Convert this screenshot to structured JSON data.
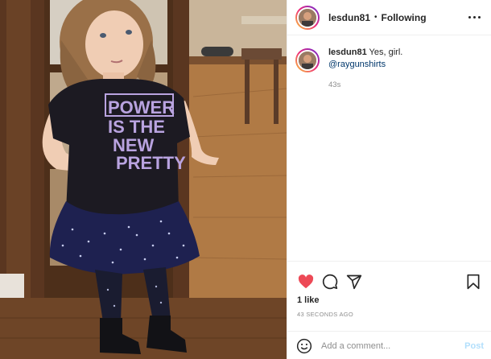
{
  "post": {
    "username": "lesdun81",
    "separator": "•",
    "follow_status": "Following",
    "shirt_text": [
      "POWER",
      "IS THE",
      "NEW",
      "PRETTY"
    ]
  },
  "caption": {
    "username": "lesdun81",
    "text": " Yes, girl.",
    "mention": "@raygunshirts",
    "time": "43s"
  },
  "actions": {
    "likes": "1 like",
    "timestamp": "43 SECONDS AGO"
  },
  "comment_box": {
    "placeholder": "Add a comment...",
    "post_label": "Post"
  },
  "colors": {
    "like_red": "#ed4956",
    "mention_blue": "#00376b",
    "post_disabled": "#b2dffc",
    "shirt_print": "#b9a3e0"
  },
  "icons": [
    "heart-icon",
    "comment-icon",
    "share-icon",
    "bookmark-icon",
    "more-icon",
    "emoji-icon"
  ]
}
